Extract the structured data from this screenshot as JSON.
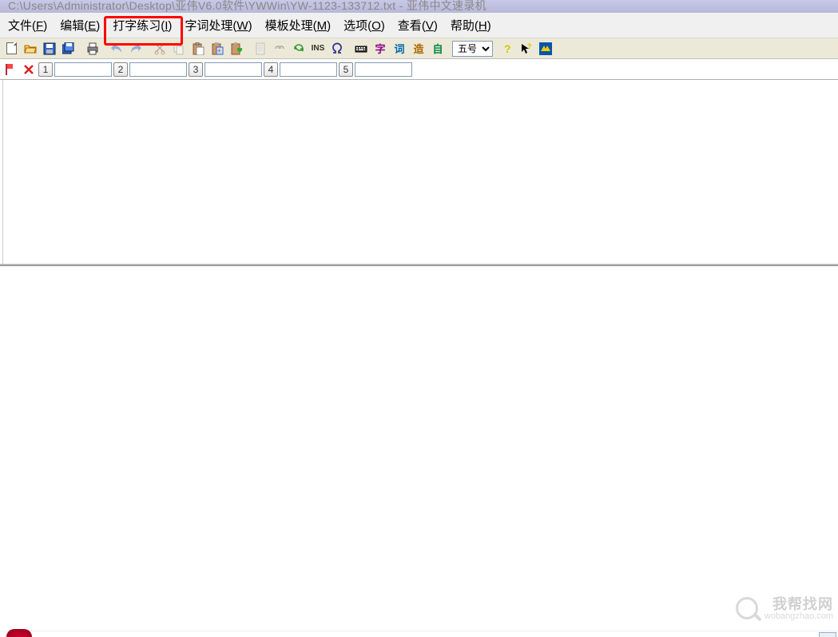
{
  "title": "C:\\Users\\Administrator\\Desktop\\亚伟V6.0软件\\YWWin\\YW-1123-133712.txt - 亚伟中文速录机",
  "menu": {
    "file": {
      "label": "文件",
      "accel": "F"
    },
    "edit": {
      "label": "编辑",
      "accel": "E"
    },
    "typing": {
      "label": "打字练习",
      "accel": "I"
    },
    "word": {
      "label": "字词处理",
      "accel": "W"
    },
    "template": {
      "label": "模板处理",
      "accel": "M"
    },
    "options": {
      "label": "选项",
      "accel": "O"
    },
    "view": {
      "label": "查看",
      "accel": "V"
    },
    "help": {
      "label": "帮助",
      "accel": "H"
    }
  },
  "toolbar": {
    "ins_label": "INS",
    "zi_label": "字",
    "ci_label": "词",
    "zao_label": "造",
    "auto_label": "自",
    "font_value": "五号"
  },
  "input_row": {
    "n1": "1",
    "n2": "2",
    "n3": "3",
    "n4": "4",
    "n5": "5",
    "v1": "",
    "v2": "",
    "v3": "",
    "v4": "",
    "v5": ""
  },
  "watermark": {
    "cn": "我帮找网",
    "en": "wobangzhao.com"
  }
}
